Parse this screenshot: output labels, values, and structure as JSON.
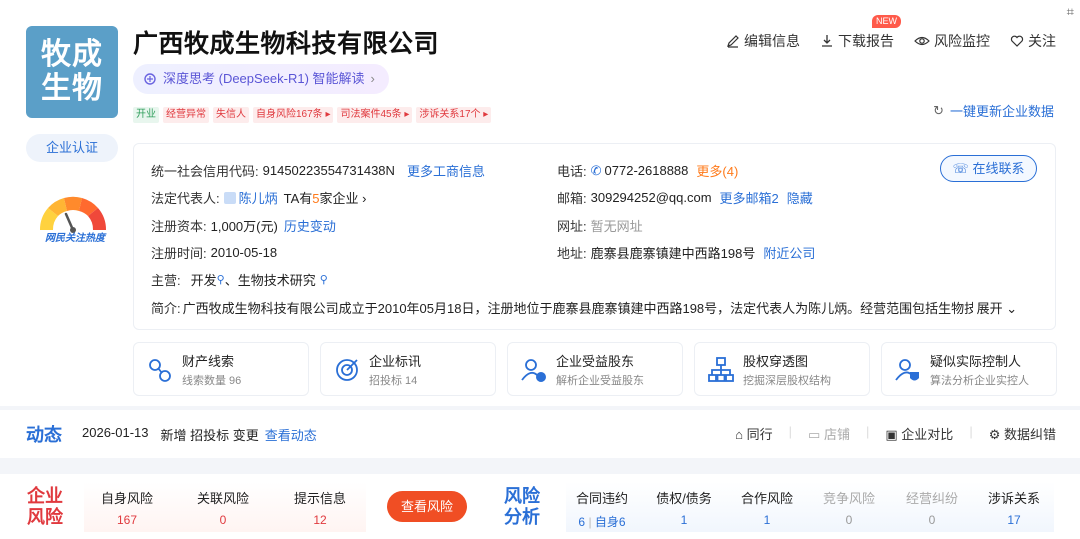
{
  "company": {
    "logo_line1": "牧成",
    "logo_line2": "生物",
    "name": "广西牧成生物科技有限公司",
    "certification": "企业认证",
    "heat_label": "网民关注热度"
  },
  "ai": {
    "label": "深度思考 (DeepSeek-R1) 智能解读",
    "icon": "ai-spark-icon"
  },
  "tags": [
    {
      "text": "开业",
      "color": "green"
    },
    {
      "text": "经营异常",
      "color": "red"
    },
    {
      "text": "失信人",
      "color": "red"
    },
    {
      "text": "自身风险167条 ▸",
      "color": "red"
    },
    {
      "text": "司法案件45条 ▸",
      "color": "red"
    },
    {
      "text": "涉诉关系17个 ▸",
      "color": "red"
    }
  ],
  "actions": {
    "edit": "编辑信息",
    "download": "下载报告",
    "download_badge": "NEW",
    "monitor": "风险监控",
    "follow": "关注"
  },
  "refresh": "一键更新企业数据",
  "info": {
    "credit_code_label": "统一社会信用代码:",
    "credit_code": "91450223554731438N",
    "more_business": "更多工商信息",
    "legal_rep_label": "法定代表人:",
    "legal_rep": "陈儿炳",
    "legal_rep_enterprises_pre": "TA有",
    "legal_rep_enterprises_num": "5",
    "legal_rep_enterprises_post": "家企业 ›",
    "capital_label": "注册资本:",
    "capital": "1,000万(元)",
    "capital_history": "历史变动",
    "reg_date_label": "注册时间:",
    "reg_date": "2010-05-18",
    "business_label": "主营:",
    "business": "开发",
    "business_sep": "、",
    "business2": "生物技术研究",
    "phone_label": "电话:",
    "phone": "0772-2618888",
    "phone_more": "更多(4)",
    "email_label": "邮箱:",
    "email": "309294252@qq.com",
    "email_more": "更多邮箱2",
    "email_hide": "隐藏",
    "website_label": "网址:",
    "website": "暂无网址",
    "address_label": "地址:",
    "address": "鹿寨县鹿寨镇建中西路198号",
    "nearby": "附近公司",
    "online_contact": "在线联系",
    "intro_label": "简介:",
    "intro": "广西牧成生物科技有限公司成立于2010年05月18日，注册地位于鹿寨县鹿寨镇建中西路198号，法定代表人为陈儿炳。经营范围包括生物技...",
    "expand": "展开"
  },
  "features": [
    {
      "title": "财产线索",
      "sub": "线索数量 96",
      "icon": "property-clue-icon"
    },
    {
      "title": "企业标讯",
      "sub": "招投标 14",
      "icon": "bidding-target-icon"
    },
    {
      "title": "企业受益股东",
      "sub": "解析企业受益股东",
      "icon": "beneficiary-icon"
    },
    {
      "title": "股权穿透图",
      "sub": "挖掘深层股权结构",
      "icon": "equity-chart-icon"
    },
    {
      "title": "疑似实际控制人",
      "sub": "算法分析企业实控人",
      "icon": "controller-icon"
    }
  ],
  "dynamic": {
    "title": "动态",
    "date": "2026-01-13",
    "text": "新增 招投标 变更",
    "link": "查看动态",
    "tools": {
      "peer": "同行",
      "shop": "店铺",
      "compare": "企业对比",
      "correction": "数据纠错"
    }
  },
  "risk": {
    "company_title_1": "企业",
    "company_title_2": "风险",
    "analysis_title_1": "风险",
    "analysis_title_2": "分析",
    "self_label": "自身风险",
    "self_value": "167",
    "related_label": "关联风险",
    "related_value": "0",
    "hint_label": "提示信息",
    "hint_value": "12",
    "button": "查看风险",
    "contract_label": "合同违约",
    "contract_value": "6",
    "contract_self": "自身6",
    "debt_label": "债权/债务",
    "debt_value": "1",
    "coop_label": "合作风险",
    "coop_value": "1",
    "compete_label": "竞争风险",
    "compete_value": "0",
    "dispute_label": "经营纠纷",
    "dispute_value": "0",
    "lawsuit_label": "涉诉关系",
    "lawsuit_value": "17"
  },
  "colors": {
    "accent": "#2a6fd6",
    "danger": "#e0393e",
    "risk_button": "#f04e24",
    "logo_bg": "#5b9fc8"
  }
}
